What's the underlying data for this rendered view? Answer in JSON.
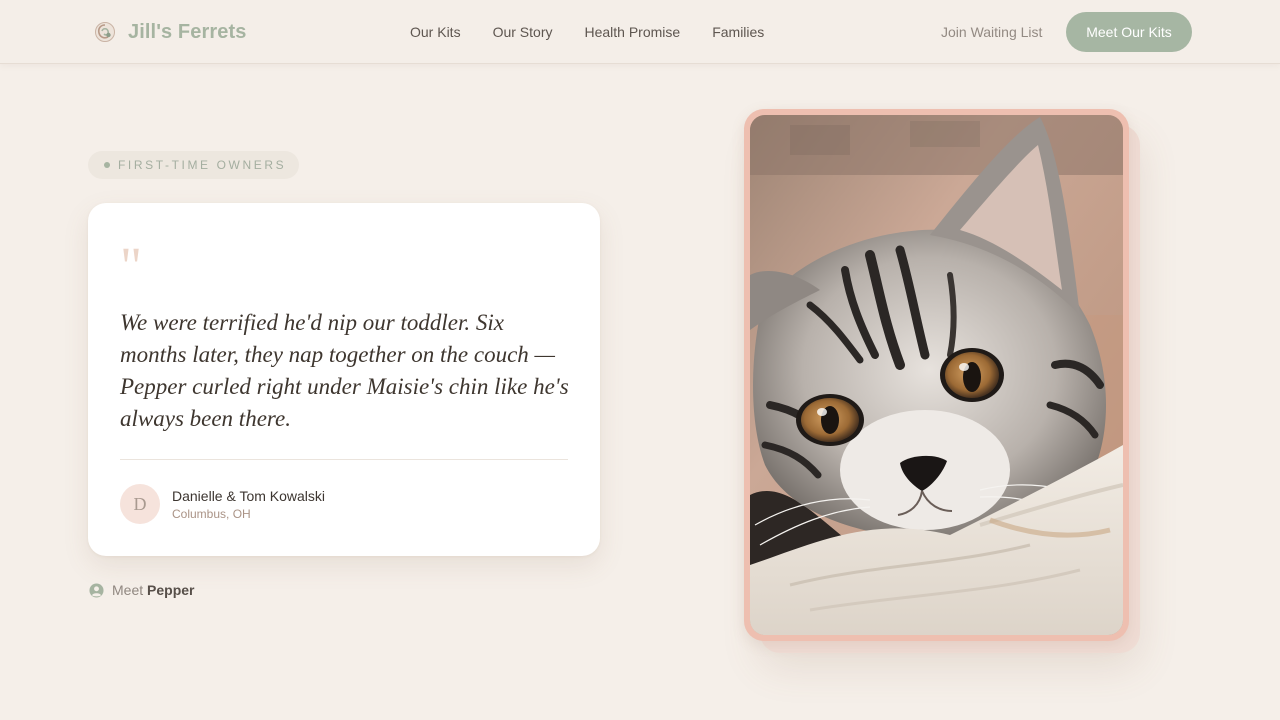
{
  "header": {
    "brand_name": "Jill's Ferrets",
    "nav": [
      {
        "label": "Our Kits"
      },
      {
        "label": "Our Story"
      },
      {
        "label": "Health Promise"
      },
      {
        "label": "Families"
      }
    ],
    "waitlist_label": "Join Waiting List",
    "cta_label": "Meet Our Kits"
  },
  "testimonial": {
    "tag": "FIRST-TIME OWNERS",
    "quote_mark": "\"",
    "quote": "We were terrified he'd nip our toddler. Six months later, they nap together on the couch — Pepper curled right under Maisie's chin like he's always been there.",
    "author": {
      "initial": "D",
      "name": "Danielle & Tom Kowalski",
      "location": "Columbus, OH"
    },
    "meet_prefix": "Meet",
    "meet_name": "Pepper"
  },
  "icons": {
    "brand": "swirl-logo-icon",
    "meet": "user-circle-icon"
  },
  "colors": {
    "background": "#f5efe9",
    "accent_sage": "#a6b6a3",
    "frame_pink": "#eebfb0",
    "text_dark": "#3c3530"
  }
}
